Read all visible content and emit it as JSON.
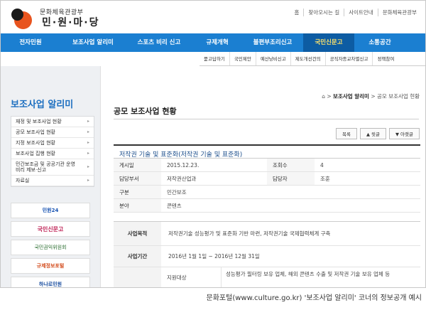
{
  "header": {
    "org": "문화체육관광부",
    "site": "민·원·마·당",
    "util_links": [
      "홈",
      "찾아오시는 길",
      "사이트안내",
      "문화체육관광부"
    ]
  },
  "gnb": {
    "items": [
      "전자민원",
      "보조사업 알리미",
      "스포츠 비리 신고",
      "규제개혁",
      "불편부조리신고",
      "국민신문고",
      "소통공간"
    ],
    "active": "국민신문고"
  },
  "subnav": {
    "items": [
      "묻고답하기",
      "국민제안",
      "예산낭비신고",
      "제도개선건의",
      "공직자종교차별신고",
      "정책참여"
    ]
  },
  "sidebar": {
    "title": "보조사업 알리미",
    "items": [
      {
        "label": "재정 및 보조사업 현황"
      },
      {
        "label": "공모 보조사업 현황"
      },
      {
        "label": "지정 보조사업 현황"
      },
      {
        "label": "보조사업 집행 현황"
      },
      {
        "label": "민간보조금 및 공공기관 운영 비리 제보·신고"
      },
      {
        "label": "자료실"
      }
    ],
    "banners": [
      "민원24",
      "국민신문고",
      "국민권익위원회",
      "규제정보포털",
      "하나로민원"
    ]
  },
  "content": {
    "breadcrumb": {
      "home": "⌂",
      "section": "보조사업 알리미",
      "current": "공모 보조사업 현황"
    },
    "page_title": "공모 보조사업 현황",
    "buttons": [
      "목록",
      "▲ 윗글",
      "▼ 아랫글"
    ],
    "post_title": "저작권 기술 및 표준화(저작권 기술 및 표준화)",
    "meta": [
      {
        "k1": "게시일",
        "v1": "2015.12.23.",
        "k2": "조회수",
        "v2": "4"
      },
      {
        "k1": "담당부서",
        "v1": "저작권산업과",
        "k2": "담당자",
        "v2": "조훈"
      },
      {
        "k1": "구분",
        "v1": "민간보조",
        "k2": "",
        "v2": ""
      },
      {
        "k1": "분야",
        "v1": "콘텐츠",
        "k2": "",
        "v2": ""
      }
    ],
    "detail": {
      "purpose_label": "사업목적",
      "purpose": "저작권기술 성능평가 및 표준화 기반 마련, 저작권기술 국제협력체계 구축",
      "period_label": "사업기간",
      "period": "2016년 1월 1일 ~ 2016년 12월 31일",
      "target_label": "지원대상",
      "target": "성능평가 필터링 보유 업체, 해외 콘텐츠 수출 및 저작권 기술 보유 업체 등"
    }
  },
  "caption": "문화포털(www.culture.go.kr) '보조사업 알리미' 코너의 정보공개 예시"
}
